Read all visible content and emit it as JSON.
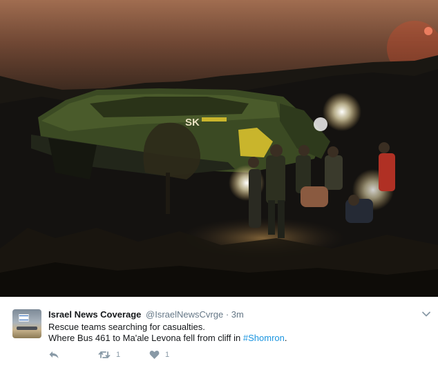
{
  "photo": {
    "alt_icon": "bus-crash-photo"
  },
  "tweet": {
    "display_name": "Israel News Coverage",
    "handle": "@IsraelNewsCvrge",
    "separator": "·",
    "time": "3m",
    "line1": "Rescue teams searching for casualties.",
    "line2_prefix": "Where Bus 461 to Ma'ale Levona fell from cliff in ",
    "hashtag": "#Shomron",
    "line2_suffix": ".",
    "retweet_count": "1",
    "like_count": "1",
    "bus_logo_text": "SK"
  },
  "icons": {
    "reply": "reply-icon",
    "retweet": "retweet-icon",
    "like": "heart-icon",
    "menu": "chevron-down-icon"
  },
  "colors": {
    "link": "#1b95e0",
    "muted": "#657786",
    "text": "#14171a"
  }
}
